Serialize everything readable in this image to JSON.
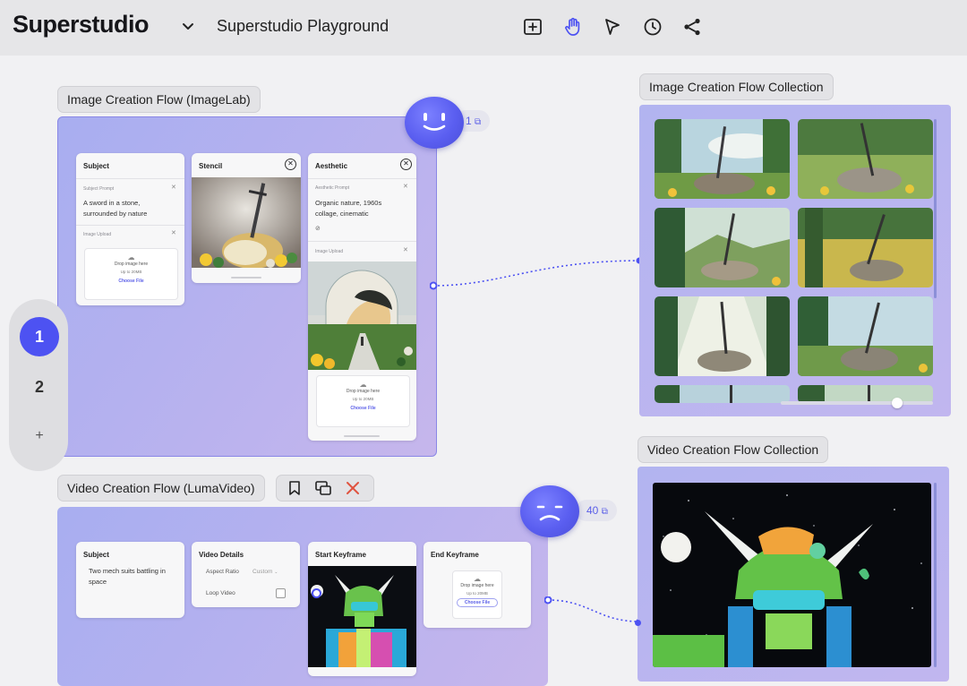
{
  "app": {
    "brand": "Superstudio",
    "workspace": "Superstudio Playground"
  },
  "toolbar": {
    "icons": [
      "add-frame-icon",
      "hand-icon",
      "pointer-icon",
      "history-icon",
      "share-icon"
    ],
    "active": "hand-icon"
  },
  "colors": {
    "accent": "#4d52f2",
    "panel": "#b5b1ef",
    "topbar": "#e6e6e8"
  },
  "image_flow": {
    "label": "Image Creation Flow (ImageLab)",
    "count": "1",
    "subject": {
      "title": "Subject",
      "prompt_label": "Subject Prompt",
      "prompt_value": "A sword in a stone, surrounded by nature",
      "upload_label": "Image Upload",
      "drop_text": "Drop image here",
      "size_text": "Up to 20MB",
      "choose_text": "Choose File"
    },
    "stencil": {
      "title": "Stencil"
    },
    "aesthetic": {
      "title": "Aesthetic",
      "prompt_label": "Aesthetic Prompt",
      "prompt_value": "Organic nature, 1960s collage, cinematic",
      "upload_label": "Image Upload",
      "drop_text": "Drop image here",
      "size_text": "Up to 20MB",
      "choose_text": "Choose File"
    }
  },
  "image_collection": {
    "label": "Image Creation Flow Collection"
  },
  "video_flow": {
    "label": "Video Creation Flow (LumaVideo)",
    "count": "40",
    "subject": {
      "title": "Subject",
      "value": "Two mech suits battling in space"
    },
    "details": {
      "title": "Video Details",
      "aspect_label": "Aspect Ratio",
      "aspect_value": "Custom",
      "loop_label": "Loop Video"
    },
    "start": {
      "title": "Start Keyframe"
    },
    "end": {
      "title": "End Keyframe",
      "drop_text": "Drop image here",
      "size_text": "Up to 20MB",
      "choose_text": "Choose File"
    }
  },
  "video_collection": {
    "label": "Video Creation Flow Collection"
  },
  "pager": {
    "pages": [
      "1",
      "2"
    ],
    "add": "+",
    "active": "1"
  }
}
